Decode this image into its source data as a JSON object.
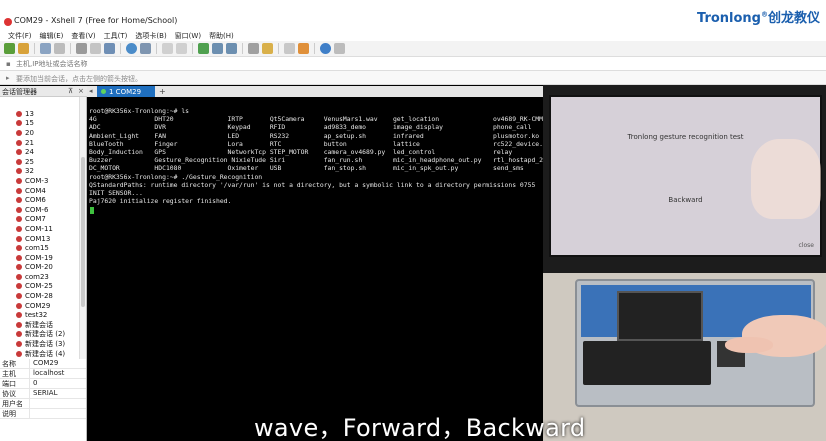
{
  "window": {
    "title": "COM29 - Xshell 7 (Free for Home/School)",
    "brand": "Tronlong",
    "brand_mark": "®",
    "brand_cn": "创龙教仪"
  },
  "menu": [
    "文件(F)",
    "编辑(E)",
    "查看(V)",
    "工具(T)",
    "选项卡(B)",
    "窗口(W)",
    "帮助(H)"
  ],
  "address_bar": {
    "placeholder": "主机,IP地址或会话名称"
  },
  "hint_bar": {
    "text": "要添加当前会话，点击左侧的箭头按钮。"
  },
  "session_manager": {
    "title": "会话管理器",
    "pin": "⊼",
    "close": "×",
    "items": [
      "13",
      "15",
      "20",
      "21",
      "24",
      "25",
      "32",
      "COM-3",
      "COM4",
      "COM6",
      "COM-6",
      "COM7",
      "COM-11",
      "COM13",
      "com15",
      "COM-19",
      "COM-20",
      "com23",
      "COM-25",
      "COM-28",
      "COM29",
      "test32",
      "新建会话",
      "新建会话 (2)",
      "新建会话 (3)",
      "新建会话 (4)"
    ],
    "properties": [
      {
        "key": "名称",
        "value": "COM29"
      },
      {
        "key": "主机",
        "value": "localhost"
      },
      {
        "key": "端口",
        "value": "0"
      },
      {
        "key": "协议",
        "value": "SERIAL"
      },
      {
        "key": "用户名",
        "value": ""
      },
      {
        "key": "说明",
        "value": ""
      }
    ]
  },
  "tabs": {
    "nav": "◂",
    "active": "1 COM29",
    "add": "+"
  },
  "terminal": {
    "lines": [
      "root@RK356x-Tronlong:~# ls",
      "4G               DHT20              IRTP       Qt5Camera     VenusMars1.wav    get_location              ov4689_RK-CMM",
      "ADC              DVR                Keypad     RFID          ad9833_demo       image_display             phone_call",
      "Ambient_Light    FAN                LED        RS232         ap_setup.sh       infrared                  plusmotor.ko",
      "BlueTooth        Finger             Lora       RTC           button            lattice                   rc522_device.",
      "Body_Induction   GPS                NetworkTcp STEP_MOTOR    camera_ov4689.py  led_control               relay",
      "Buzzer           Gesture_Recognition NixieTude Siri          fan_run.sh        mic_in_headphone_out.py   rtl_hostapd_2",
      "DC_MOTOR         HDC1080            Oximeter   USB           fan_stop.sh       mic_in_spk_out.py         send_sms",
      "root@RK356x-Tronlong:~# ./Gesture_Recognition",
      "QStandardPaths: runtime directory '/var/run' is not a directory, but a symbolic link to a directory permissions 0755",
      "INIT SENSOR...",
      "Paj7620 initialize register finished."
    ]
  },
  "video": {
    "screen_title": "Tronlong gesture recognition test",
    "screen_direction": "Backward",
    "screen_close": "close"
  },
  "subtitle": "wave，Forward，Backward"
}
